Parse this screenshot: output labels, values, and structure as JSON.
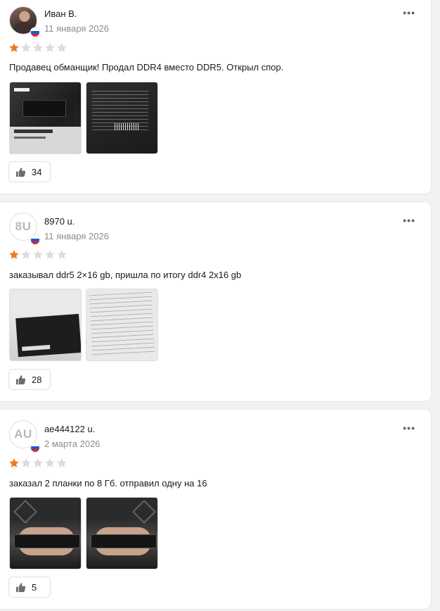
{
  "colors": {
    "star_filled": "#f07a1c",
    "star_empty": "#dcdcdc",
    "secondary_text": "#8c8c8c"
  },
  "reviews": [
    {
      "author": "Иван В.",
      "avatar_initials": "",
      "date": "11 января 2026",
      "rating": 1,
      "text": "Продавец обманщик! Продал DDR4 вместо DDR5. Открыл спор.",
      "likes": "34"
    },
    {
      "author": "8970 u.",
      "avatar_initials": "8U",
      "date": "11 января 2026",
      "rating": 1,
      "text": "заказывал ddr5 2×16 gb, пришла по итогу ddr4 2x16 gb",
      "likes": "28"
    },
    {
      "author": "ae444122 u.",
      "avatar_initials": "AU",
      "date": "2 марта 2026",
      "rating": 1,
      "text": "заказал 2 планки по 8 Гб. отправил одну на 16",
      "likes": "5"
    }
  ]
}
